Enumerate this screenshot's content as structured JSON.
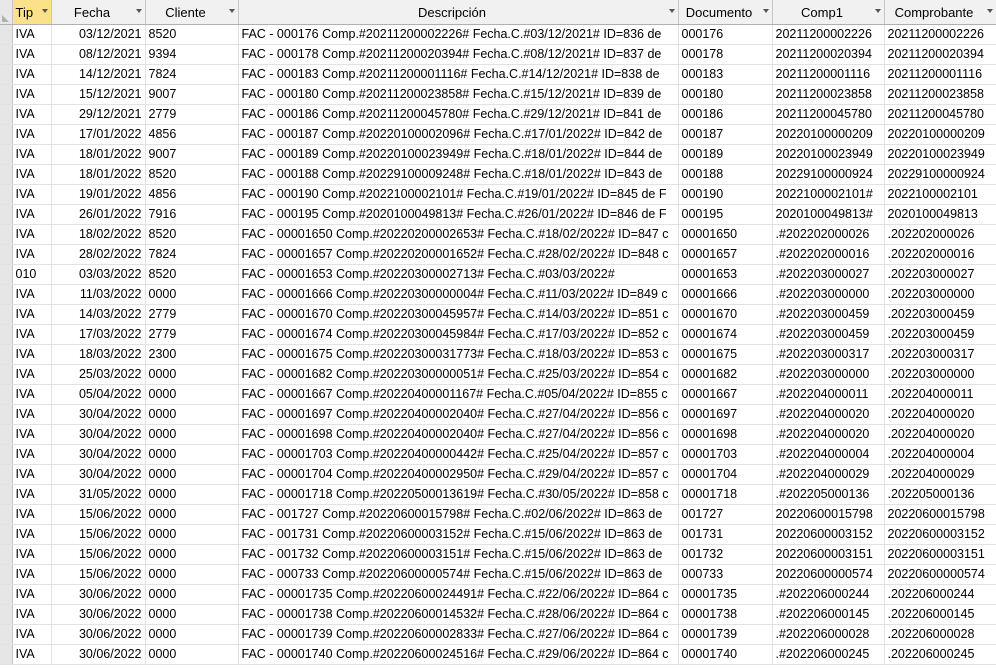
{
  "columns": [
    {
      "key": "tip",
      "label": "Tip"
    },
    {
      "key": "fecha",
      "label": "Fecha"
    },
    {
      "key": "cliente",
      "label": "Cliente"
    },
    {
      "key": "descripcion",
      "label": "Descripción"
    },
    {
      "key": "documento",
      "label": "Documento"
    },
    {
      "key": "comp1",
      "label": "Comp1"
    },
    {
      "key": "comprobante",
      "label": "Comprobante"
    }
  ],
  "rows": [
    [
      "IVA",
      "03/12/2021",
      "8520",
      "FAC - 000176 Comp.#20211200002226# Fecha.C.#03/12/2021# ID=836 de",
      "000176",
      "20211200002226",
      "20211200002226"
    ],
    [
      "IVA",
      "08/12/2021",
      "9394",
      "FAC - 000178 Comp.#20211200020394# Fecha.C.#08/12/2021# ID=837 de",
      "000178",
      "20211200020394",
      "20211200020394"
    ],
    [
      "IVA",
      "14/12/2021",
      "7824",
      "FAC - 000183 Comp.#20211200001116# Fecha.C.#14/12/2021# ID=838 de",
      "000183",
      "20211200001116",
      "20211200001116"
    ],
    [
      "IVA",
      "15/12/2021",
      "9007",
      "FAC - 000180 Comp.#20211200023858# Fecha.C.#15/12/2021# ID=839 de",
      "000180",
      "20211200023858",
      "20211200023858"
    ],
    [
      "IVA",
      "29/12/2021",
      "2779",
      "FAC - 000186 Comp.#20211200045780# Fecha.C.#29/12/2021# ID=841 de",
      "000186",
      "20211200045780",
      "20211200045780"
    ],
    [
      "IVA",
      "17/01/2022",
      "4856",
      "FAC - 000187 Comp.#20220100002096# Fecha.C.#17/01/2022# ID=842 de",
      "000187",
      "20220100000209",
      "20220100000209"
    ],
    [
      "IVA",
      "18/01/2022",
      "9007",
      "FAC - 000189 Comp.#20220100023949# Fecha.C.#18/01/2022# ID=844 de",
      "000189",
      "20220100023949",
      "20220100023949"
    ],
    [
      "IVA",
      "18/01/2022",
      "8520",
      "FAC - 000188 Comp.#20229100009248# Fecha.C.#18/01/2022# ID=843 de",
      "000188",
      "20229100000924",
      "20229100000924"
    ],
    [
      "IVA",
      "19/01/2022",
      "4856",
      "FAC - 000190 Comp.#2022100002101# Fecha.C.#19/01/2022# ID=845 de F",
      "000190",
      "2022100002101#",
      "2022100002101"
    ],
    [
      "IVA",
      "26/01/2022",
      "7916",
      "FAC - 000195 Comp.#2020100049813# Fecha.C.#26/01/2022# ID=846 de F",
      "000195",
      "2020100049813#",
      "2020100049813"
    ],
    [
      "IVA",
      "18/02/2022",
      "8520",
      "FAC - 00001650 Comp.#20220200002653# Fecha.C.#18/02/2022# ID=847 c",
      "00001650",
      ".#202202000026",
      ".202202000026"
    ],
    [
      "IVA",
      "28/02/2022",
      "7824",
      "FAC - 00001657 Comp.#20220200001652# Fecha.C.#28/02/2022# ID=848 c",
      "00001657",
      ".#202202000016",
      ".202202000016"
    ],
    [
      "010",
      "03/03/2022",
      "8520",
      "FAC - 00001653 Comp.#20220300002713#  Fecha.C.#03/03/2022#",
      "00001653",
      ".#202203000027",
      ".202203000027"
    ],
    [
      "IVA",
      "11/03/2022",
      "0000",
      "FAC - 00001666 Comp.#20220300000004# Fecha.C.#11/03/2022# ID=849 c",
      "00001666",
      ".#202203000000",
      ".202203000000"
    ],
    [
      "IVA",
      "14/03/2022",
      "2779",
      "FAC - 00001670 Comp.#20220300045957# Fecha.C.#14/03/2022# ID=851 c",
      "00001670",
      ".#202203000459",
      ".202203000459"
    ],
    [
      "IVA",
      "17/03/2022",
      "2779",
      "FAC - 00001674 Comp.#20220300045984# Fecha.C.#17/03/2022# ID=852 c",
      "00001674",
      ".#202203000459",
      ".202203000459"
    ],
    [
      "IVA",
      "18/03/2022",
      "2300",
      "FAC - 00001675 Comp.#20220300031773# Fecha.C.#18/03/2022# ID=853 c",
      "00001675",
      ".#202203000317",
      ".202203000317"
    ],
    [
      "IVA",
      "25/03/2022",
      "0000",
      "FAC - 00001682 Comp.#20220300000051# Fecha.C.#25/03/2022# ID=854 c",
      "00001682",
      ".#202203000000",
      ".202203000000"
    ],
    [
      "IVA",
      "05/04/2022",
      "0000",
      "FAC - 00001667 Comp.#20220400001167# Fecha.C.#05/04/2022# ID=855 c",
      "00001667",
      ".#202204000011",
      ".202204000011"
    ],
    [
      "IVA",
      "30/04/2022",
      "0000",
      "FAC - 00001697 Comp.#20220400002040# Fecha.C.#27/04/2022# ID=856 c",
      "00001697",
      ".#202204000020",
      ".202204000020"
    ],
    [
      "IVA",
      "30/04/2022",
      "0000",
      "FAC - 00001698 Comp.#20220400002040# Fecha.C.#27/04/2022# ID=856 c",
      "00001698",
      ".#202204000020",
      ".202204000020"
    ],
    [
      "IVA",
      "30/04/2022",
      "0000",
      "FAC - 00001703 Comp.#20220400000442# Fecha.C.#25/04/2022# ID=857 c",
      "00001703",
      ".#202204000004",
      ".202204000004"
    ],
    [
      "IVA",
      "30/04/2022",
      "0000",
      "FAC - 00001704 Comp.#20220400002950# Fecha.C.#29/04/2022# ID=857 c",
      "00001704",
      ".#202204000029",
      ".202204000029"
    ],
    [
      "IVA",
      "31/05/2022",
      "0000",
      "FAC - 00001718 Comp.#20220500013619# Fecha.C.#30/05/2022# ID=858 c",
      "00001718",
      ".#202205000136",
      ".202205000136"
    ],
    [
      "IVA",
      "15/06/2022",
      "0000",
      "FAC - 001727 Comp.#20220600015798# Fecha.C.#02/06/2022# ID=863 de",
      "001727",
      "20220600015798",
      "20220600015798"
    ],
    [
      "IVA",
      "15/06/2022",
      "0000",
      "FAC - 001731 Comp.#20220600003152# Fecha.C.#15/06/2022# ID=863 de",
      "001731",
      "20220600003152",
      "20220600003152"
    ],
    [
      "IVA",
      "15/06/2022",
      "0000",
      "FAC - 001732 Comp.#20220600003151# Fecha.C.#15/06/2022# ID=863 de",
      "001732",
      "20220600003151",
      "20220600003151"
    ],
    [
      "IVA",
      "15/06/2022",
      "0000",
      "FAC - 000733 Comp.#20220600000574# Fecha.C.#15/06/2022# ID=863 de",
      "000733",
      "20220600000574",
      "20220600000574"
    ],
    [
      "IVA",
      "30/06/2022",
      "0000",
      "FAC - 00001735 Comp.#20220600024491# Fecha.C.#22/06/2022# ID=864 c",
      "00001735",
      ".#202206000244",
      ".202206000244"
    ],
    [
      "IVA",
      "30/06/2022",
      "0000",
      "FAC - 00001738 Comp.#20220600014532# Fecha.C.#28/06/2022# ID=864 c",
      "00001738",
      ".#202206000145",
      ".202206000145"
    ],
    [
      "IVA",
      "30/06/2022",
      "0000",
      "FAC - 00001739 Comp.#20220600002833# Fecha.C.#27/06/2022# ID=864 c",
      "00001739",
      ".#202206000028",
      ".202206000028"
    ],
    [
      "IVA",
      "30/06/2022",
      "0000",
      "FAC - 00001740 Comp.#20220600024516# Fecha.C.#29/06/2022# ID=864 c",
      "00001740",
      ".#202206000245",
      ".202206000245"
    ]
  ],
  "colors": {
    "sorted_header": "#fbe28a",
    "header": "#f1f1f1",
    "grid": "#e2e2e2"
  },
  "icons": {
    "header_dropdown": "chevron-down-icon"
  }
}
